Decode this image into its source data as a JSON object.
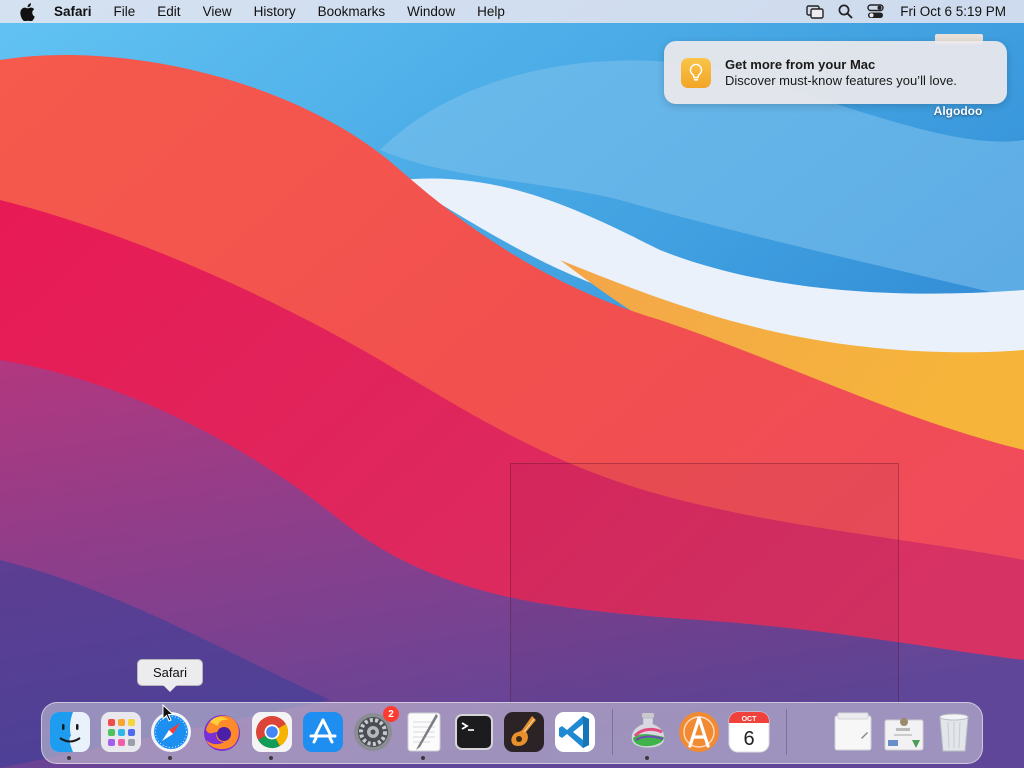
{
  "menubar": {
    "app_name": "Safari",
    "menus": [
      "File",
      "Edit",
      "View",
      "History",
      "Bookmarks",
      "Window",
      "Help"
    ],
    "clock": "Fri Oct 6  5:19 PM",
    "status_icons": [
      "screen-mirroring-icon",
      "spotlight-search-icon",
      "control-center-icon"
    ]
  },
  "notification": {
    "title": "Get more from your Mac",
    "body": "Discover must-know features you’ll love.",
    "icon": "lightbulb-icon"
  },
  "desktop": {
    "icon_label": "Algodoo"
  },
  "tooltip": {
    "text": "Safari"
  },
  "dock": {
    "items": [
      {
        "name": "Finder",
        "icon": "finder-icon",
        "running": true
      },
      {
        "name": "Launchpad",
        "icon": "launchpad-icon",
        "running": false
      },
      {
        "name": "Safari",
        "icon": "safari-icon",
        "running": true
      },
      {
        "name": "Firefox",
        "icon": "firefox-icon",
        "running": false
      },
      {
        "name": "Google Chrome",
        "icon": "chrome-icon",
        "running": true
      },
      {
        "name": "App Store",
        "icon": "app-store-icon",
        "running": false
      },
      {
        "name": "System Preferences",
        "icon": "system-preferences-icon",
        "running": false,
        "badge": "2"
      },
      {
        "name": "TextEdit",
        "icon": "textedit-icon",
        "running": true
      },
      {
        "name": "Terminal",
        "icon": "terminal-icon",
        "running": false
      },
      {
        "name": "GarageBand",
        "icon": "garageband-icon",
        "running": false
      },
      {
        "name": "Visual Studio Code",
        "icon": "vscode-icon",
        "running": false
      },
      {
        "name": "Algodoo",
        "icon": "algodoo-icon",
        "running": true
      },
      {
        "name": "Anaconda",
        "icon": "anaconda-icon",
        "running": false
      },
      {
        "name": "Calendar",
        "icon": "calendar-icon",
        "running": false,
        "month": "OCT",
        "day": "6"
      },
      {
        "name": "Documents",
        "icon": "documents-stack-icon",
        "running": false
      },
      {
        "name": "Downloads",
        "icon": "downloads-stack-icon",
        "running": false
      },
      {
        "name": "Trash",
        "icon": "trash-icon",
        "running": false
      }
    ]
  }
}
